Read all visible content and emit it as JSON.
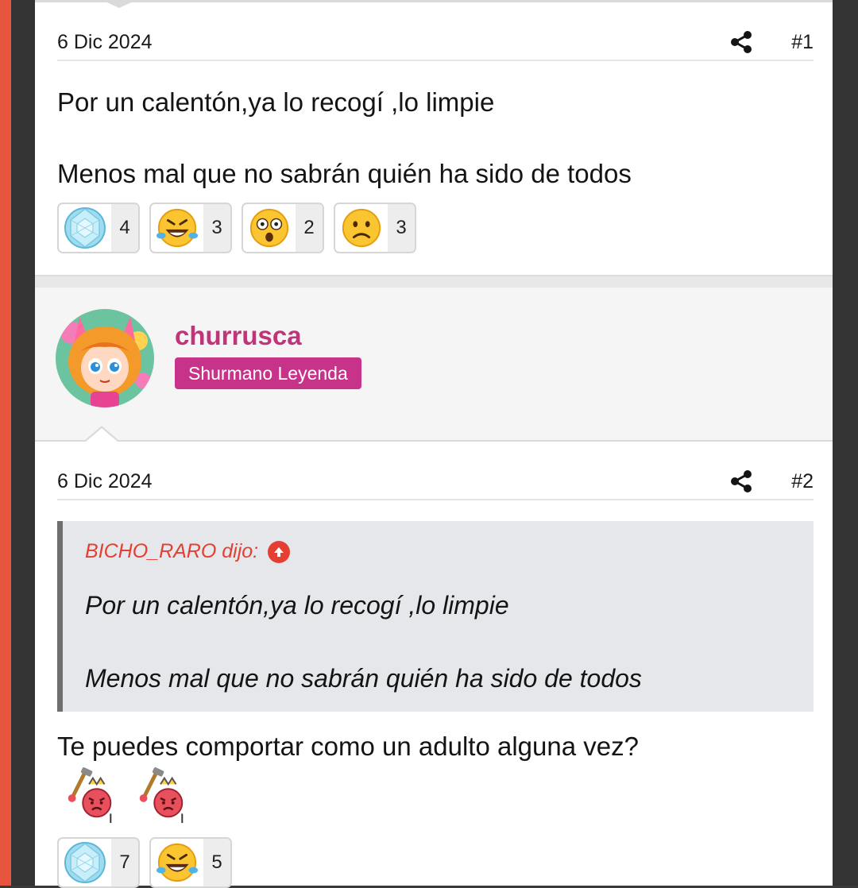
{
  "posts": [
    {
      "date": "6 Dic 2024",
      "number": "#1",
      "paragraphs": [
        "Por un calentón,ya lo recogí ,lo limpie",
        "Menos mal que no sabrán quién ha sido de todos"
      ],
      "reactions": [
        {
          "icon": "diamond-icon",
          "count": "4"
        },
        {
          "icon": "laughing-icon",
          "count": "3"
        },
        {
          "icon": "shocked-icon",
          "count": "2"
        },
        {
          "icon": "sad-icon",
          "count": "3"
        }
      ]
    },
    {
      "date": "6 Dic 2024",
      "number": "#2",
      "quote": {
        "author": "BICHO_RARO dijo:",
        "paragraphs": [
          "Por un calentón,ya lo recogí ,lo limpie",
          "Menos mal que no sabrán quién ha sido de todos"
        ]
      },
      "text": "Te puedes comportar como un adulto alguna vez?",
      "inline_smileys": [
        "angry-hammer-icon",
        "angry-hammer-icon"
      ],
      "reactions": [
        {
          "icon": "diamond-icon",
          "count": "7"
        },
        {
          "icon": "laughing-icon",
          "count": "5"
        }
      ]
    }
  ],
  "user": {
    "name": "churrusca",
    "title": "Shurmano Leyenda"
  },
  "colors": {
    "username": "#c0357a",
    "badge": "#c8338a",
    "quote_author": "#e53f33",
    "left_edge": "#e8553f"
  }
}
